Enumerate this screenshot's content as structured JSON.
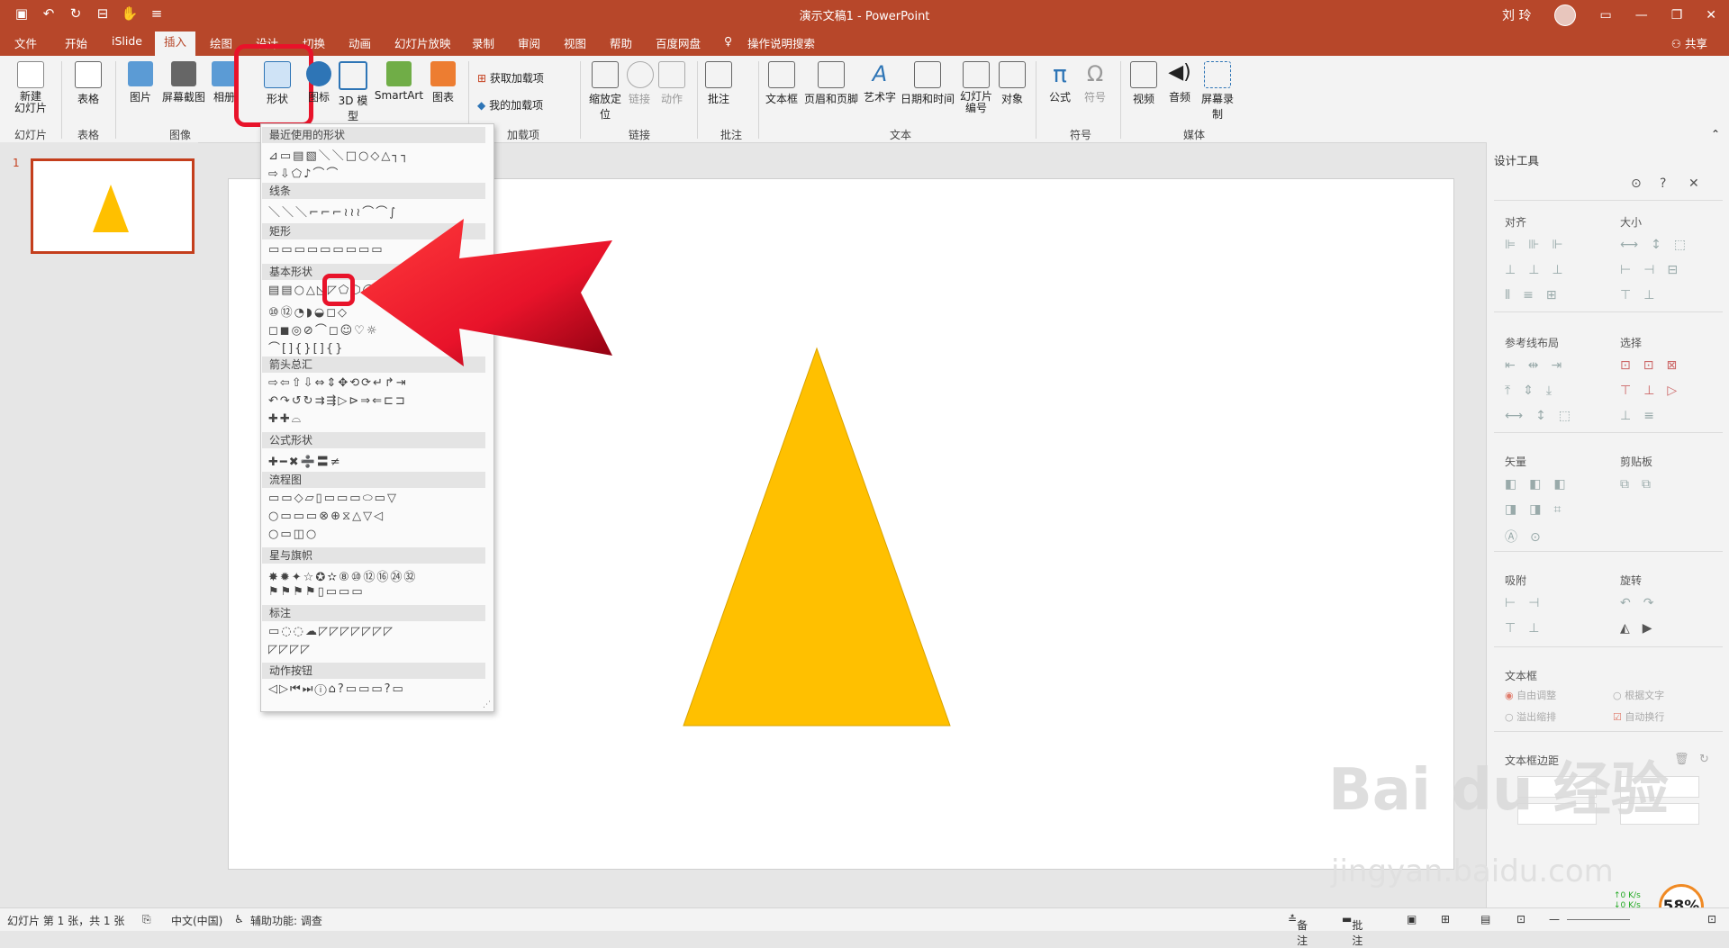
{
  "window": {
    "title": "演示文稿1 - PowerPoint",
    "user": "刘 玲"
  },
  "tabs": [
    "文件",
    "开始",
    "iSlide",
    "插入",
    "绘图",
    "设计",
    "切换",
    "动画",
    "幻灯片放映",
    "录制",
    "审阅",
    "视图",
    "帮助",
    "百度网盘"
  ],
  "active_tab": "插入",
  "tell_me": "操作说明搜索",
  "share": "共享",
  "ribbon": {
    "new_slide": "新建\n幻灯片",
    "table": "表格",
    "picture": "图片",
    "screenshot": "屏幕截图",
    "album": "相册",
    "shapes": "形状",
    "icons": "图标",
    "model3d": "3D 模型",
    "smartart": "SmartArt",
    "chart": "图表",
    "get_addins": "获取加载项",
    "my_addins": "我的加载项",
    "zoom": "缩放定位",
    "link": "链接",
    "action": "动作",
    "comment": "批注",
    "textbox": "文本框",
    "header_footer": "页眉和页脚",
    "wordart": "艺术字",
    "datetime": "日期和时间",
    "slide_number": "幻灯片编号",
    "object": "对象",
    "equation": "公式",
    "symbol": "符号",
    "video": "视频",
    "audio": "音频",
    "screen_record": "屏幕录制",
    "groups": {
      "slides": "幻灯片",
      "tables": "表格",
      "images": "图像",
      "addins": "加载项",
      "links": "链接",
      "comments": "批注",
      "text": "文本",
      "symbols": "符号",
      "media": "媒体"
    }
  },
  "gallery": {
    "sections": [
      "最近使用的形状",
      "线条",
      "矩形",
      "基本形状",
      "箭头总汇",
      "公式形状",
      "流程图",
      "星与旗帜",
      "标注",
      "动作按钮"
    ],
    "rows": {
      "recent1": "⊿▭▤▧＼＼□○◇△┐┐",
      "recent2": "⇨⇩⬠♪⌒⌒",
      "lines": "＼＼＼⌐⌐⌐≀≀≀⌒⌒∫",
      "rect": "▭▭▭▭▭▭▭▭▭",
      "basic1": "▤▤○△◺◸⬠⬡◯◯◻",
      "basic2": "⑩⑫◔◗◒◻◇",
      "basic3": "◻◼◎⊘⌒◻☺♡☼",
      "basic4": "⌒[]{}[]{}",
      "arrows1": "⇨⇦⇧⇩⇔⇕✥⟲⟳↵↱⇥",
      "arrows2": "↶↷↺↻⇉⇶▷⊳⇒⇐⊏⊐",
      "arrows3": "✚✚⌓",
      "math": "✚━✖➗〓≠",
      "flow1": "▭▭◇▱▯▭▭▭⬭▭▽",
      "flow2": "○▭▭▭⊗⊕⧖△▽◁",
      "flow3": "○▭◫○",
      "stars1": "✸✹✦☆✪✫⑧⑩⑫⑯㉔㉜",
      "stars2": "⚑⚑⚑⚑▯▭▭▭",
      "callouts1": "▭◌◌☁◸◸◸◸◸◸◸",
      "callouts2": "◸◸◸◸",
      "actions": "◁▷⏮⏭ⓘ⌂?▭▭▭?▭"
    }
  },
  "pane": {
    "title": "设计工具",
    "sections": [
      "对齐",
      "大小",
      "参考线布局",
      "选择",
      "矢量",
      "剪贴板",
      "吸附",
      "旋转",
      "文本框",
      "文本框边距"
    ],
    "textbox_options": [
      "自由调整",
      "根据文字",
      "溢出缩排",
      "自动换行"
    ]
  },
  "slide_number": "1",
  "status": {
    "slide_info": "幻灯片 第 1 张，共 1 张",
    "language": "中文(中国)",
    "accessibility": "辅助功能: 调查",
    "notes": "备注",
    "comments": "批注",
    "net_up": "0  K/s",
    "net_down": "0  K/s",
    "speed": "58%"
  },
  "watermark": {
    "line1": "Bai du 经验",
    "line2": "jingyan.baidu.com"
  },
  "colors": {
    "brand": "#b7472a",
    "triangle": "#ffc000",
    "arrow": "#e8132a",
    "highlight": "#e8132a"
  }
}
